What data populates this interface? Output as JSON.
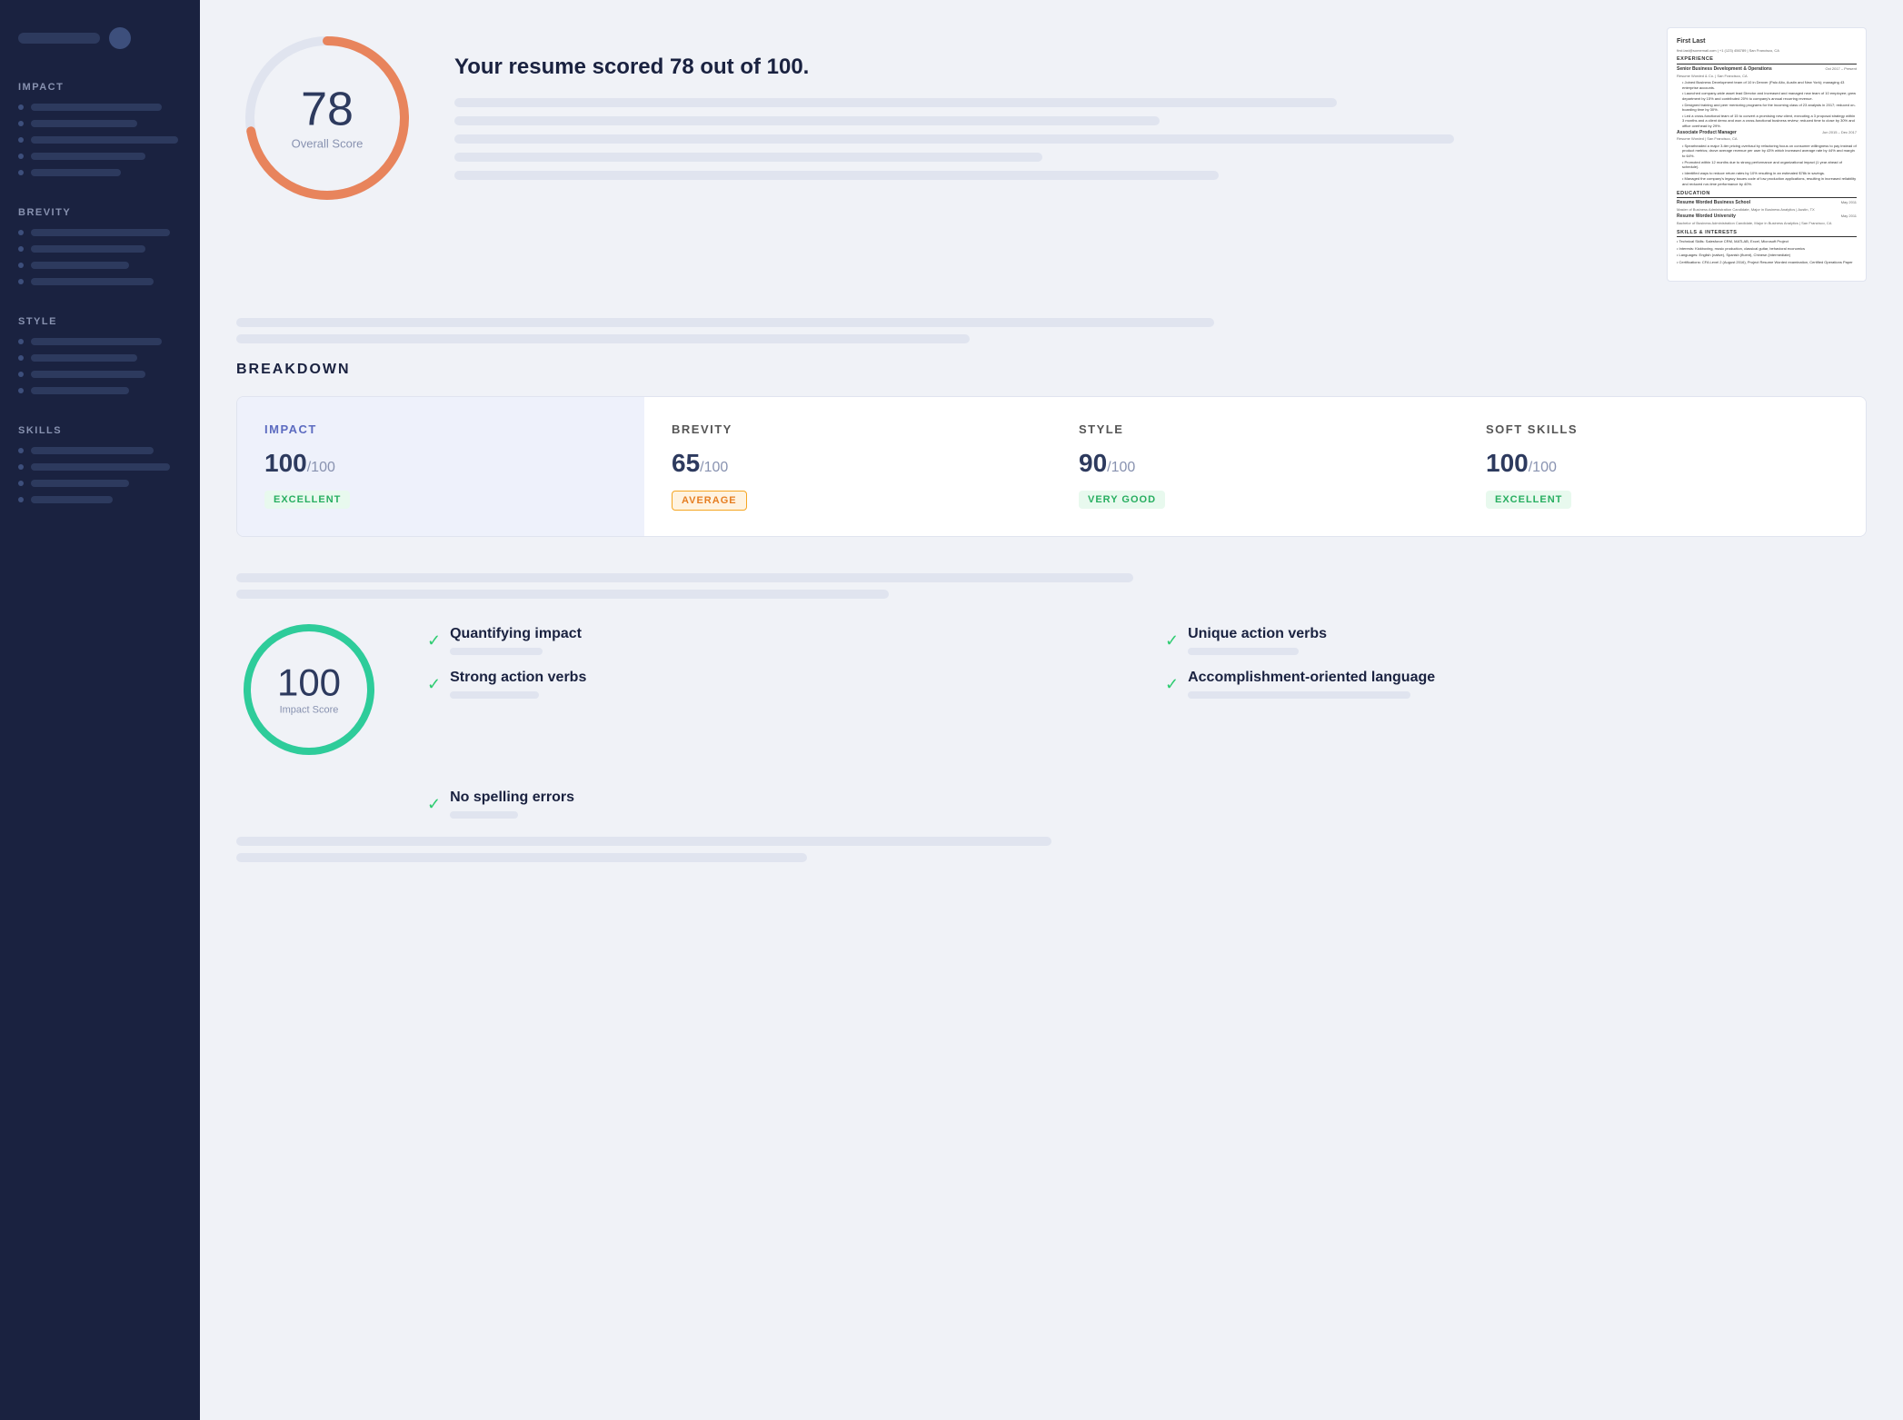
{
  "sidebar": {
    "sections": [
      {
        "title": "IMPACT",
        "items": [
          {
            "bar_width": "80%"
          },
          {
            "bar_width": "65%"
          },
          {
            "bar_width": "90%"
          },
          {
            "bar_width": "70%"
          },
          {
            "bar_width": "55%"
          }
        ]
      },
      {
        "title": "BREVITY",
        "items": [
          {
            "bar_width": "85%"
          },
          {
            "bar_width": "70%"
          },
          {
            "bar_width": "60%"
          },
          {
            "bar_width": "75%"
          }
        ]
      },
      {
        "title": "STYLE",
        "items": [
          {
            "bar_width": "80%"
          },
          {
            "bar_width": "65%"
          },
          {
            "bar_width": "70%"
          },
          {
            "bar_width": "60%"
          }
        ]
      },
      {
        "title": "SKILLS",
        "items": [
          {
            "bar_width": "75%"
          },
          {
            "bar_width": "85%"
          },
          {
            "bar_width": "60%"
          },
          {
            "bar_width": "50%"
          }
        ]
      }
    ]
  },
  "header": {
    "score_value": "78",
    "score_label": "Overall Score",
    "headline": "Your resume scored 78 out of 100.",
    "score_bars": [
      {
        "width": "75%"
      },
      {
        "width": "60%"
      },
      {
        "width": "85%"
      },
      {
        "width": "50%"
      },
      {
        "width": "65%"
      }
    ]
  },
  "breakdown": {
    "title": "BREAKDOWN",
    "columns": [
      {
        "title": "IMPACT",
        "title_class": "impact",
        "score": "100",
        "total": "100",
        "badge": "EXCELLENT",
        "badge_class": "badge-excellent",
        "highlighted": true
      },
      {
        "title": "BREVITY",
        "title_class": "brevity",
        "score": "65",
        "total": "100",
        "badge": "AVERAGE",
        "badge_class": "badge-average",
        "highlighted": false
      },
      {
        "title": "STYLE",
        "title_class": "style",
        "score": "90",
        "total": "100",
        "badge": "VERY GOOD",
        "badge_class": "badge-verygood",
        "highlighted": false
      },
      {
        "title": "SOFT SKILLS",
        "title_class": "softskills",
        "score": "100",
        "total": "100",
        "badge": "EXCELLENT",
        "badge_class": "badge-excellent",
        "highlighted": false
      }
    ]
  },
  "impact_detail": {
    "score": "100",
    "label": "Impact Score",
    "checks": [
      {
        "text": "Quantifying impact",
        "subbar_width": "70%"
      },
      {
        "text": "Unique action verbs",
        "subbar_width": "80%"
      },
      {
        "text": "Strong action verbs",
        "subbar_width": "65%"
      },
      {
        "text": "Accomplishment-oriented language",
        "subbar_width": "90%"
      }
    ],
    "single_checks": [
      {
        "text": "No spelling errors",
        "subbar_width": "55%"
      }
    ],
    "section_bars": [
      {
        "width": "60%"
      },
      {
        "width": "75%"
      }
    ]
  },
  "resume": {
    "name": "First Last",
    "contact": "first.last@somemail.com | +1 (123) 456789 | San Francisco, CA",
    "experience_title": "EXPERIENCE",
    "jobs": [
      {
        "title": "Senior Business Development & Operations",
        "company": "Resume Worded & Co.",
        "dates": "Oct 2017 – Present",
        "location": "San Francisco, CA",
        "bullets": [
          "Joined Business Development team of 10 in Denver (Palo Alto, Austin and New York); managing 43 enterprise accounts.",
          "Launched company-wide asset lead Director and increased and managed new team of 10 employee; grew department by 15% and contributed 20% to company's annual recurring revenue.",
          "Designed training and peer mentoring programs for the incoming class of 23 analysts in 2017; reduced on-boarding time by 30%.",
          "Led a cross-functional team of 15 to convert a promising new client, executing a 3 proposal strategy within 3 months and a client demo and won a cross-functional business review; reduced time to close by 30% and office overhead by 29%."
        ]
      },
      {
        "title": "Associate Product Manager",
        "company": "Resume Worded",
        "dates": "Jun 2015 – Dec 2017",
        "location": "San Francisco, CA",
        "bullets": [
          "Spearheaded a major 3-tier pricing overhaul by refactoring focus on consumer willingness to pay instead of product metrics; drove average revenue per user by 43% which increased average rate by 44% and margin to 64%.",
          "Promoted within 12 months due to strong performance and organizational impact (1 year ahead of schedule).",
          "Identified ways to reduce return rates by 10% resulting in an estimated $78k in savings.",
          "Managed the company's legacy issues code of low production applications, resulting in increased reliability and reduced run-time performance by 40%."
        ]
      }
    ],
    "education_title": "EDUCATION",
    "schools": [
      {
        "name": "Resume Worded Business School",
        "degree": "Master of Business Administration Candidate, Major in Business Analytics",
        "date": "May 2011",
        "location": "Austin, TX"
      },
      {
        "name": "Resume Worded University",
        "degree": "Bachelor of Business Administration Candidate, Major in Business Analytics",
        "date": "May 2011",
        "location": "San Francisco, CA"
      }
    ],
    "skills_title": "SKILLS & INTERESTS",
    "skills": [
      "Technical Skills: Salesforce CRM, MATLAB, Excel, Microsoft Project",
      "Interests: Kickboxing, music production, classical guitar, behavioral economics",
      "Languages: English (native), Spanish (fluent), Chinese (intermediate)",
      "Certifications: CFA Level 2 (August 2016), Project Resume Worded examination, Certified Operations Paper"
    ]
  }
}
